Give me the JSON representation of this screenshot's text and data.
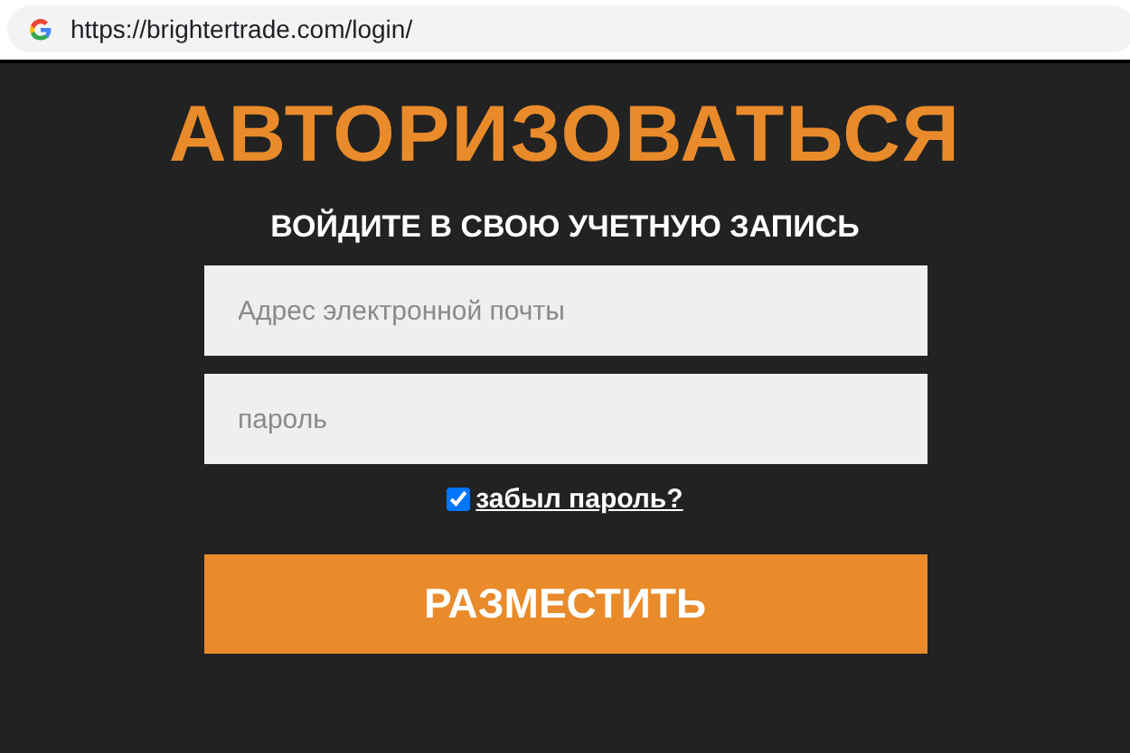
{
  "address_bar": {
    "url": "https://brightertrade.com/login/"
  },
  "title": "АВТОРИЗОВАТЬСЯ",
  "subtitle": "ВОЙДИТЕ В СВОЮ УЧЕТНУЮ ЗАПИСЬ",
  "fields": [
    {
      "placeholder": "Адрес электронной почты"
    },
    {
      "placeholder": "пароль"
    }
  ],
  "remember": {
    "checked": true,
    "link": "забыл пароль?"
  },
  "submit_button": "РАЗМЕСТИТЬ"
}
